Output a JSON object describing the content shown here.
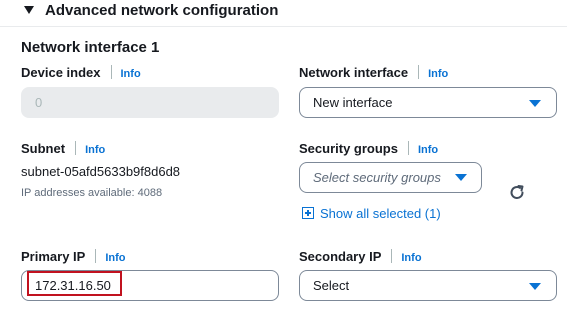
{
  "section": {
    "title": "Advanced network configuration"
  },
  "heading": "Network interface 1",
  "info_label": "Info",
  "device_index": {
    "label": "Device index",
    "value": "0"
  },
  "network_interface": {
    "label": "Network interface",
    "value": "New interface"
  },
  "subnet": {
    "label": "Subnet",
    "value": "subnet-05afd5633b9f8d6d8",
    "ip_available": "IP addresses available: 4088"
  },
  "security_groups": {
    "label": "Security groups",
    "placeholder": "Select security groups",
    "show_all": "Show all selected (1)"
  },
  "primary_ip": {
    "label": "Primary IP",
    "value": "172.31.16.50"
  },
  "secondary_ip": {
    "label": "Secondary IP",
    "value": "Select"
  },
  "colors": {
    "link": "#0972d3",
    "highlight": "#c1121f",
    "text": "#16191f"
  },
  "icons": [
    "caret-down-icon",
    "dropdown-arrow-icon",
    "plus-square-icon",
    "refresh-icon"
  ]
}
